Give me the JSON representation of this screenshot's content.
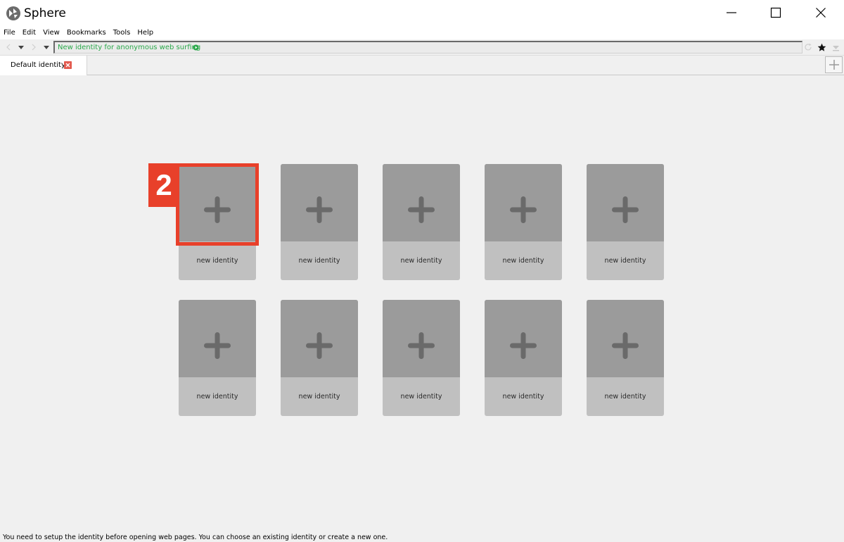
{
  "window": {
    "title": "Sphere",
    "logo_icon": "sphere-logo-icon"
  },
  "menu": {
    "items": [
      "File",
      "Edit",
      "View",
      "Bookmarks",
      "Tools",
      "Help"
    ]
  },
  "toolbar": {
    "address_text": "New identity for anonymous web surfing",
    "address_color": "#2aa84a"
  },
  "tabs": {
    "items": [
      {
        "label": "Default identity"
      }
    ]
  },
  "identities": {
    "rows": [
      [
        "new identity",
        "new identity",
        "new identity",
        "new identity",
        "new identity"
      ],
      [
        "new identity",
        "new identity",
        "new identity",
        "new identity",
        "new identity"
      ]
    ]
  },
  "annotation": {
    "number": "2",
    "color": "#e8402a"
  },
  "status": {
    "text": "You need to setup the identity before opening web pages. You can choose an existing identity or create a new one."
  }
}
